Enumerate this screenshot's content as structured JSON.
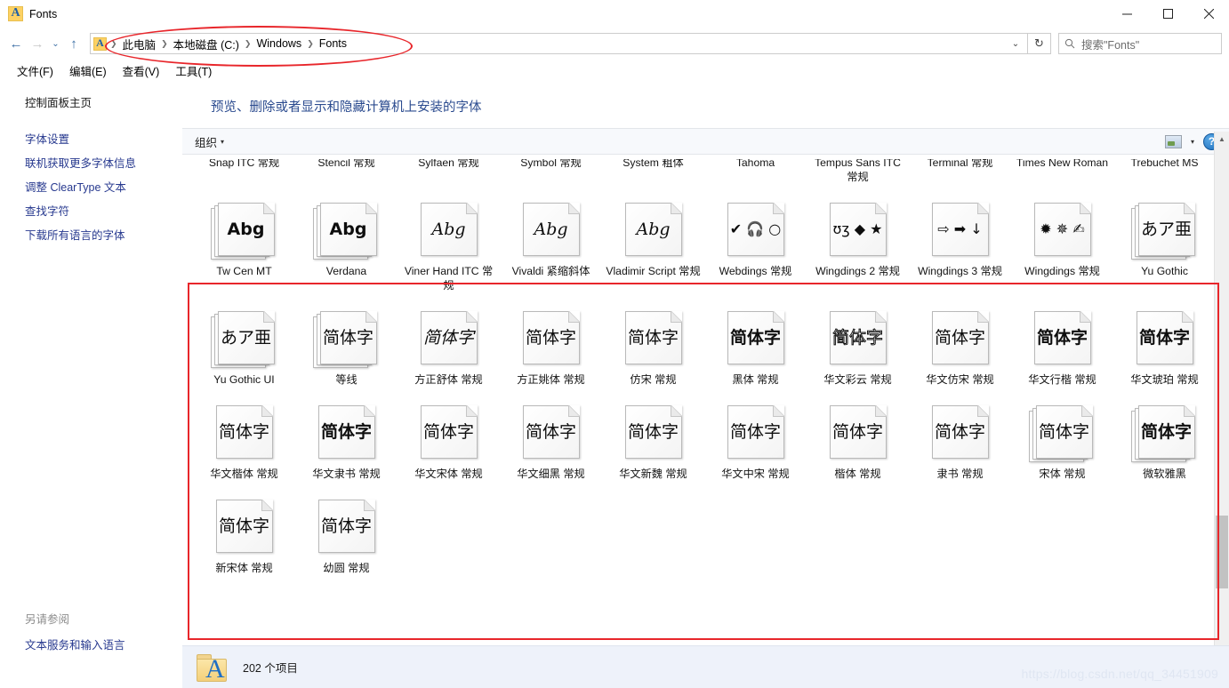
{
  "window": {
    "title": "Fonts",
    "icon": "font-file-icon",
    "minimize": "minimize-icon",
    "maximize": "maximize-icon",
    "close": "close-icon"
  },
  "address": {
    "back": "back-arrow-icon",
    "forward": "forward-arrow-icon",
    "recent": "chevron-down-icon",
    "up": "up-arrow-icon",
    "breadcrumbs": [
      "此电脑",
      "本地磁盘 (C:)",
      "Windows",
      "Fonts"
    ],
    "dropdown": "chevron-down-icon",
    "refresh": "refresh-icon"
  },
  "search": {
    "placeholder": "搜索\"Fonts\"",
    "icon": "search-icon",
    "value": ""
  },
  "menubar": {
    "items": [
      "文件(F)",
      "编辑(E)",
      "查看(V)",
      "工具(T)"
    ]
  },
  "sidebar": {
    "home": "控制面板主页",
    "links": [
      "字体设置",
      "联机获取更多字体信息",
      "调整 ClearType 文本",
      "查找字符",
      "下载所有语言的字体"
    ],
    "see_also_header": "另请参阅",
    "see_also_links": [
      "文本服务和输入语言"
    ]
  },
  "main": {
    "heading": "预览、删除或者显示和隐藏计算机上安装的字体",
    "toolbar": {
      "organize": "组织",
      "organize_caret": "▾",
      "view_icon": "view-layout-icon",
      "view_caret": "▾",
      "help_icon": "help-icon",
      "help_label": "?"
    }
  },
  "fonts": {
    "rows": [
      {
        "clipped": true,
        "cells": [
          {
            "label": "Snap ITC 常规",
            "sample": "",
            "stacked": false,
            "style": ""
          },
          {
            "label": "Stencil 常规",
            "sample": "",
            "stacked": false,
            "style": ""
          },
          {
            "label": "Sylfaen 常规",
            "sample": "",
            "stacked": false,
            "style": ""
          },
          {
            "label": "Symbol 常规",
            "sample": "",
            "stacked": false,
            "style": ""
          },
          {
            "label": "System 粗体",
            "sample": "",
            "stacked": false,
            "style": ""
          },
          {
            "label": "Tahoma",
            "sample": "",
            "stacked": true,
            "style": ""
          },
          {
            "label": "Tempus Sans ITC 常规",
            "sample": "",
            "stacked": false,
            "style": ""
          },
          {
            "label": "Terminal 常规",
            "sample": "",
            "stacked": false,
            "style": ""
          },
          {
            "label": "Times New Roman",
            "sample": "",
            "stacked": true,
            "style": ""
          },
          {
            "label": "Trebuchet MS",
            "sample": "",
            "stacked": true,
            "style": ""
          }
        ]
      },
      {
        "clipped": false,
        "cells": [
          {
            "label": "Tw Cen MT",
            "sample": "Abg",
            "stacked": true,
            "style": "bold"
          },
          {
            "label": "Verdana",
            "sample": "Abg",
            "stacked": true,
            "style": "bold"
          },
          {
            "label": "Viner Hand ITC 常规",
            "sample": "Abg",
            "stacked": false,
            "style": "italic"
          },
          {
            "label": "Vivaldi 紧缩斜体",
            "sample": "Abg",
            "stacked": false,
            "style": "italic"
          },
          {
            "label": "Vladimir Script 常规",
            "sample": "Abg",
            "stacked": false,
            "style": "italic"
          },
          {
            "label": "Webdings 常规",
            "sample": "✔ 🎧 ○",
            "stacked": false,
            "style": "small"
          },
          {
            "label": "Wingdings 2 常规",
            "sample": "ʊʒ ◆ ★",
            "stacked": false,
            "style": "small"
          },
          {
            "label": "Wingdings 3 常规",
            "sample": "⇨ ➡ ↓",
            "stacked": false,
            "style": "small"
          },
          {
            "label": "Wingdings 常规",
            "sample": "✹ ✵ ✍",
            "stacked": false,
            "style": "small"
          },
          {
            "label": "Yu Gothic",
            "sample": "あア亜",
            "stacked": true,
            "style": ""
          }
        ]
      },
      {
        "clipped": false,
        "cells": [
          {
            "label": "Yu Gothic UI",
            "sample": "あア亜",
            "stacked": true,
            "style": ""
          },
          {
            "label": "等线",
            "sample": "简体字",
            "stacked": true,
            "style": ""
          },
          {
            "label": "方正舒体 常规",
            "sample": "简体字",
            "stacked": false,
            "style": "italic"
          },
          {
            "label": "方正姚体 常规",
            "sample": "简体字",
            "stacked": false,
            "style": "serif"
          },
          {
            "label": "仿宋 常规",
            "sample": "简体字",
            "stacked": false,
            "style": "serif"
          },
          {
            "label": "黑体 常规",
            "sample": "简体字",
            "stacked": false,
            "style": "bold"
          },
          {
            "label": "华文彩云 常规",
            "sample": "简体字",
            "stacked": false,
            "style": "outline"
          },
          {
            "label": "华文仿宋 常规",
            "sample": "简体字",
            "stacked": false,
            "style": "serif"
          },
          {
            "label": "华文行楷 常规",
            "sample": "简体字",
            "stacked": false,
            "style": "bold"
          },
          {
            "label": "华文琥珀 常规",
            "sample": "简体字",
            "stacked": false,
            "style": "bold"
          }
        ]
      },
      {
        "clipped": false,
        "cells": [
          {
            "label": "华文楷体 常规",
            "sample": "简体字",
            "stacked": false,
            "style": "serif"
          },
          {
            "label": "华文隶书 常规",
            "sample": "简体字",
            "stacked": false,
            "style": "bold"
          },
          {
            "label": "华文宋体 常规",
            "sample": "简体字",
            "stacked": false,
            "style": "serif"
          },
          {
            "label": "华文细黑 常规",
            "sample": "简体字",
            "stacked": false,
            "style": ""
          },
          {
            "label": "华文新魏 常规",
            "sample": "简体字",
            "stacked": false,
            "style": "serif"
          },
          {
            "label": "华文中宋 常规",
            "sample": "简体字",
            "stacked": false,
            "style": "serif"
          },
          {
            "label": "楷体 常规",
            "sample": "简体字",
            "stacked": false,
            "style": "serif"
          },
          {
            "label": "隶书 常规",
            "sample": "简体字",
            "stacked": false,
            "style": "serif"
          },
          {
            "label": "宋体 常规",
            "sample": "简体字",
            "stacked": true,
            "style": "serif"
          },
          {
            "label": "微软雅黑",
            "sample": "简体字",
            "stacked": true,
            "style": "bold"
          }
        ]
      },
      {
        "clipped": false,
        "cells": [
          {
            "label": "新宋体 常规",
            "sample": "简体字",
            "stacked": false,
            "style": "serif"
          },
          {
            "label": "幼圆 常规",
            "sample": "简体字",
            "stacked": false,
            "style": ""
          }
        ]
      }
    ]
  },
  "status": {
    "item_count": "202 个项目",
    "folder_icon": "fonts-folder-icon"
  },
  "annotations": {
    "ellipse_color": "#e8262b",
    "rect_color": "#e8262b",
    "watermark": "https://blog.csdn.net/qq_34451909"
  },
  "scrollbar": {
    "up": "scroll-up-arrow-icon",
    "down": "scroll-down-arrow-icon"
  }
}
